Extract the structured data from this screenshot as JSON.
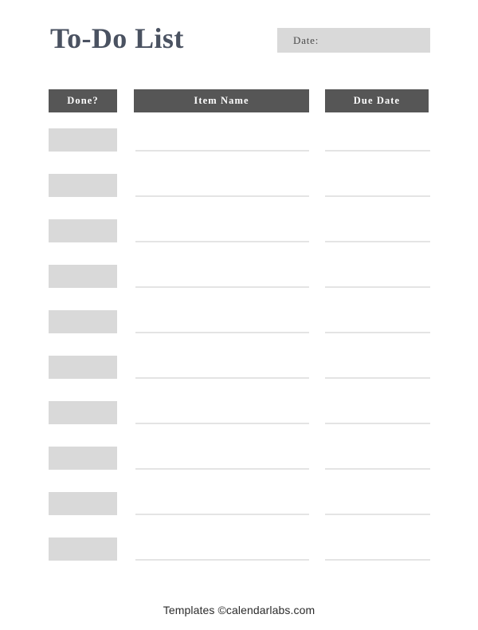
{
  "document": {
    "title": "To-Do List",
    "background_color": "#ffffff"
  },
  "header": {
    "title": "To-Do List",
    "title_color": "#4a5261",
    "date_field": {
      "label": "Date:",
      "value": "",
      "placeholder": "",
      "box_color": "#d9d9d9"
    }
  },
  "table": {
    "header_background": "#565656",
    "header_text_color": "#ffffff",
    "columns": [
      {
        "key": "done",
        "label": "Done?"
      },
      {
        "key": "item",
        "label": "Item Name"
      },
      {
        "key": "due",
        "label": "Due Date"
      }
    ],
    "row_count": 10,
    "checkbox_color": "#d9d9d9",
    "line_color": "#e4e4e4",
    "rows": [
      {
        "done": "",
        "item": "",
        "due": ""
      },
      {
        "done": "",
        "item": "",
        "due": ""
      },
      {
        "done": "",
        "item": "",
        "due": ""
      },
      {
        "done": "",
        "item": "",
        "due": ""
      },
      {
        "done": "",
        "item": "",
        "due": ""
      },
      {
        "done": "",
        "item": "",
        "due": ""
      },
      {
        "done": "",
        "item": "",
        "due": ""
      },
      {
        "done": "",
        "item": "",
        "due": ""
      },
      {
        "done": "",
        "item": "",
        "due": ""
      },
      {
        "done": "",
        "item": "",
        "due": ""
      }
    ]
  },
  "footer": {
    "text": "Templates ©calendarlabs.com"
  }
}
